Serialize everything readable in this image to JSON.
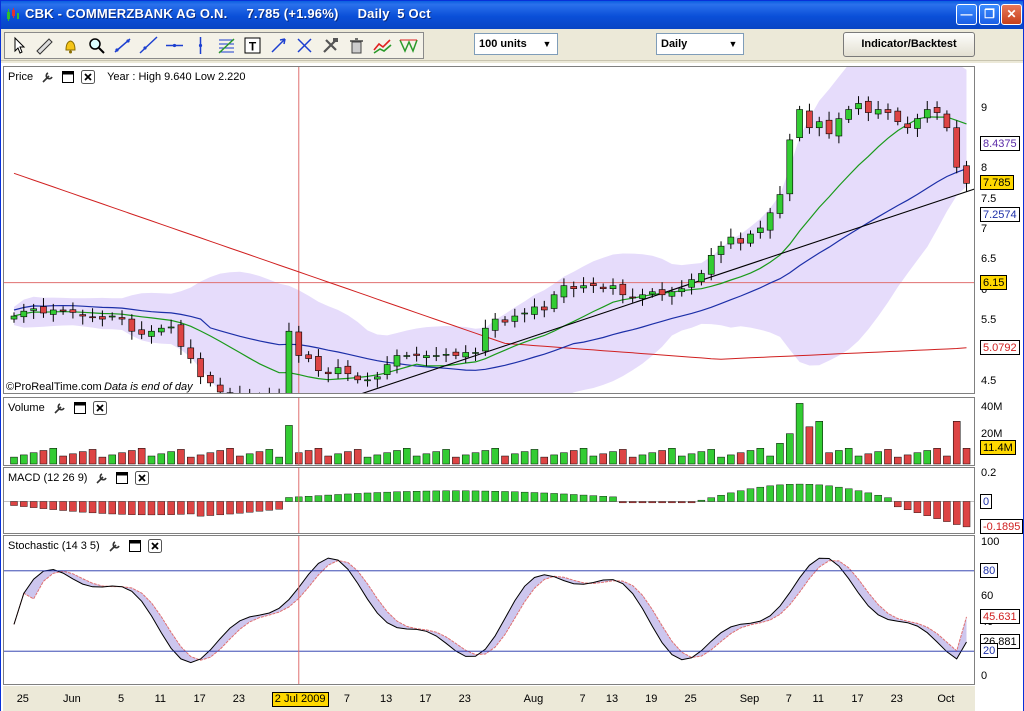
{
  "window": {
    "title": "CBK - COMMERZBANK AG O.N.     7.785 (+1.96%)     Daily  5 Oct",
    "colors": {
      "titlebar": "#0a4fd8",
      "face": "#ece9d8"
    }
  },
  "toolbar": {
    "tools": [
      "pointer-tool",
      "ruler-tool",
      "alert-bell-tool",
      "zoom-tool",
      "trendline-tool",
      "ray-tool",
      "horizontal-line-tool",
      "vertical-line-tool",
      "fibonacci-tool",
      "text-tool",
      "arrows-tool",
      "crossed-arrows-tool",
      "wrench-hammer-tool",
      "trash-tool",
      "indicator-compare-tool",
      "zigzag-tool"
    ],
    "units_select": "100 units",
    "period_select": "Daily",
    "indicator_button": "Indicator/Backtest"
  },
  "panes": {
    "price": {
      "label": "Price",
      "info": "Year : High 9.640 Low 2.220",
      "copyright": "©ProRealTime.com",
      "data_note": "Data is end of day",
      "ticks": [
        "9",
        "8",
        "7.5",
        "7",
        "6.5",
        "6",
        "5.5",
        "5",
        "4.5"
      ],
      "tags": {
        "ma_top": "8.4375",
        "last": "7.785",
        "ma_mid": "7.2574",
        "cursor": "6.15",
        "ma_long": "5.0792"
      }
    },
    "volume": {
      "label": "Volume",
      "ticks": [
        "40M",
        "20M"
      ],
      "tags": {
        "last": "11.4M"
      }
    },
    "macd": {
      "label": "MACD (12 26 9)",
      "ticks": [
        "0.2",
        "0"
      ],
      "tags": {
        "zero": "0",
        "last": "-0.1895"
      }
    },
    "stochastic": {
      "label": "Stochastic (14 3 5)",
      "ticks": [
        "100",
        "80",
        "60",
        "40",
        "20",
        "0"
      ],
      "tags": {
        "upper": "80",
        "k": "45.631",
        "d": "26.881",
        "lower": "20"
      }
    }
  },
  "x_axis": {
    "labels": [
      "25",
      "Jun",
      "5",
      "11",
      "17",
      "23",
      "7",
      "13",
      "17",
      "23",
      "Aug",
      "7",
      "13",
      "19",
      "25",
      "Sep",
      "7",
      "11",
      "17",
      "23",
      "Oct"
    ],
    "cursor_date": "2 Jul 2009"
  },
  "chart_data": {
    "type": "candlestick",
    "title": "CBK - COMMERZBANK AG O.N.",
    "period": "Daily",
    "last": 7.785,
    "change_pct": 1.96,
    "ylim": [
      4.3,
      9.7
    ],
    "closes": [
      5.6,
      5.68,
      5.72,
      5.65,
      5.7,
      5.68,
      5.66,
      5.6,
      5.58,
      5.55,
      5.6,
      5.55,
      5.35,
      5.3,
      5.35,
      5.4,
      5.42,
      5.1,
      4.9,
      4.6,
      4.5,
      4.35,
      4.3,
      4.25,
      4.3,
      4.28,
      4.3,
      4.3,
      5.35,
      4.95,
      4.9,
      4.7,
      4.65,
      4.75,
      4.65,
      4.55,
      4.55,
      4.6,
      4.8,
      4.95,
      4.95,
      4.95,
      4.95,
      4.95,
      4.97,
      4.95,
      5.0,
      5.0,
      5.4,
      5.55,
      5.5,
      5.6,
      5.65,
      5.75,
      5.7,
      5.95,
      6.1,
      6.05,
      6.1,
      6.1,
      6.05,
      6.1,
      5.95,
      5.9,
      5.95,
      6.0,
      5.95,
      6.0,
      6.05,
      6.2,
      6.3,
      6.6,
      6.75,
      6.9,
      6.8,
      6.95,
      7.05,
      7.3,
      7.6,
      8.5,
      9.0,
      8.7,
      8.8,
      8.6,
      8.85,
      9.0,
      9.1,
      8.95,
      9.0,
      8.95,
      8.8,
      8.7,
      8.85,
      9.0,
      8.95,
      8.7,
      8.05,
      7.785
    ],
    "ma_short": 8.4375,
    "ma_mid": 7.2574,
    "ma_long": 5.0792,
    "volume": {
      "unit": "M",
      "ylim": [
        0,
        45
      ],
      "last": 11.4
    },
    "macd": {
      "params": [
        12,
        26,
        9
      ],
      "last": -0.1895,
      "ylim": [
        -0.25,
        0.25
      ]
    },
    "stochastic": {
      "params": [
        14,
        3,
        5
      ],
      "k": 45.631,
      "d": 26.881,
      "levels": [
        20,
        80
      ]
    }
  }
}
